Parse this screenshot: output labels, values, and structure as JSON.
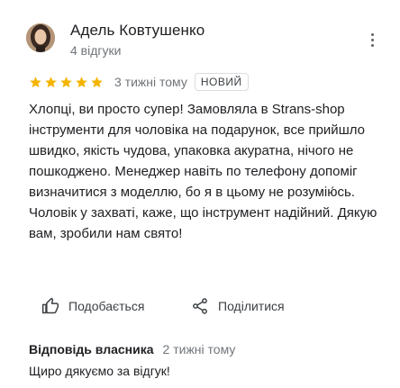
{
  "reviewer": {
    "name": "Адель Ковтушенко",
    "review_count": "4 відгуки"
  },
  "review": {
    "rating": 5,
    "rating_max": 5,
    "date": "3 тижні тому",
    "badge": "НОВИЙ",
    "text": "Хлопці, ви просто супер! Замовляла в Strans-shop інструменти для чоловіка на подарунок, все прийшло швидко, якість чудова, упаковка акуратна, нічого не пошкоджено. Менеджер навіть по телефону допоміг визначитися з моделлю, бо я в цьому не розумію́сь. Чоловік у захваті, каже, що інструмент надійний. Дякую вам, зробили нам свято!"
  },
  "actions": {
    "like_label": "Подобається",
    "share_label": "Поділитися"
  },
  "owner_reply": {
    "label": "Відповідь власника",
    "date": "2 тижні тому",
    "text": "Щиро дякуємо за відгук!"
  },
  "colors": {
    "star": "#f4b400",
    "text": "#202124",
    "secondary": "#70757a"
  },
  "icons": {
    "more": "more-vert-icon",
    "like": "thumb-up-icon",
    "share": "share-icon",
    "star": "star-icon"
  }
}
